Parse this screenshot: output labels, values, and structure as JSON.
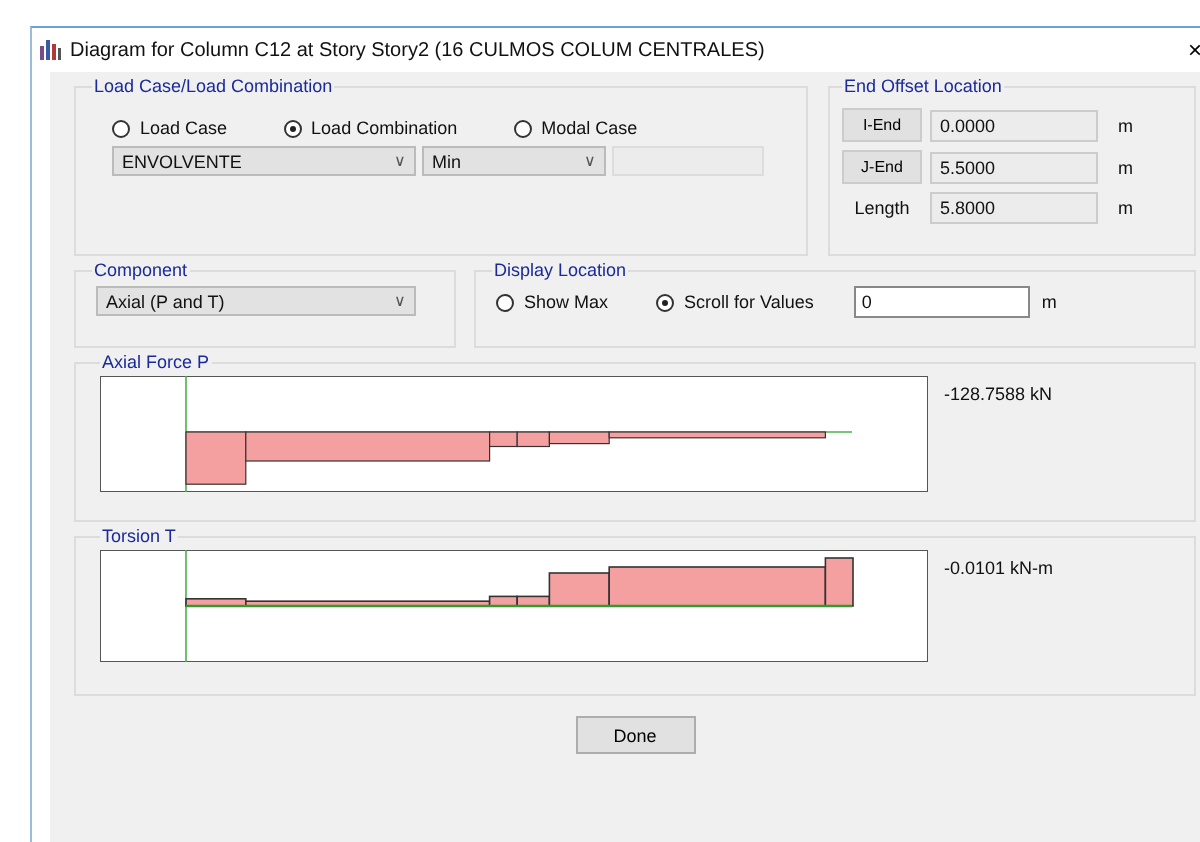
{
  "window": {
    "title": "Diagram for Column C12 at Story Story2 (16 CULMOS COLUM CENTRALES)",
    "close": "×"
  },
  "load_case": {
    "title": "Load Case/Load Combination",
    "options": [
      {
        "label": "Load Case",
        "selected": false
      },
      {
        "label": "Load Combination",
        "selected": true
      },
      {
        "label": "Modal Case",
        "selected": false
      }
    ],
    "dropdowns": [
      {
        "value": "ENVOLVENTE",
        "caret": "∨"
      },
      {
        "value": "Min",
        "caret": "∨"
      }
    ]
  },
  "end_offset": {
    "title": "End Offset Location",
    "rows": [
      {
        "kind": "button",
        "label": "I-End",
        "value": "0.0000",
        "unit": "m"
      },
      {
        "kind": "button",
        "label": "J-End",
        "value": "5.5000",
        "unit": "m"
      },
      {
        "kind": "text",
        "label": "Length",
        "value": "5.8000",
        "unit": "m"
      }
    ]
  },
  "component": {
    "title": "Component",
    "value": "Axial (P and T)",
    "caret": "∨"
  },
  "display_location": {
    "title": "Display Location",
    "options": [
      {
        "label": "Show Max",
        "selected": false
      },
      {
        "label": "Scroll for Values",
        "selected": true
      }
    ],
    "value": "0",
    "unit": "m"
  },
  "diagrams": [
    {
      "kind": "axial",
      "title": "Axial Force P",
      "reading": "-128.7588 kN"
    },
    {
      "kind": "torsion",
      "title": "Torsion T",
      "reading": "-0.0101 kN-m"
    }
  ],
  "done_button": "Done"
}
